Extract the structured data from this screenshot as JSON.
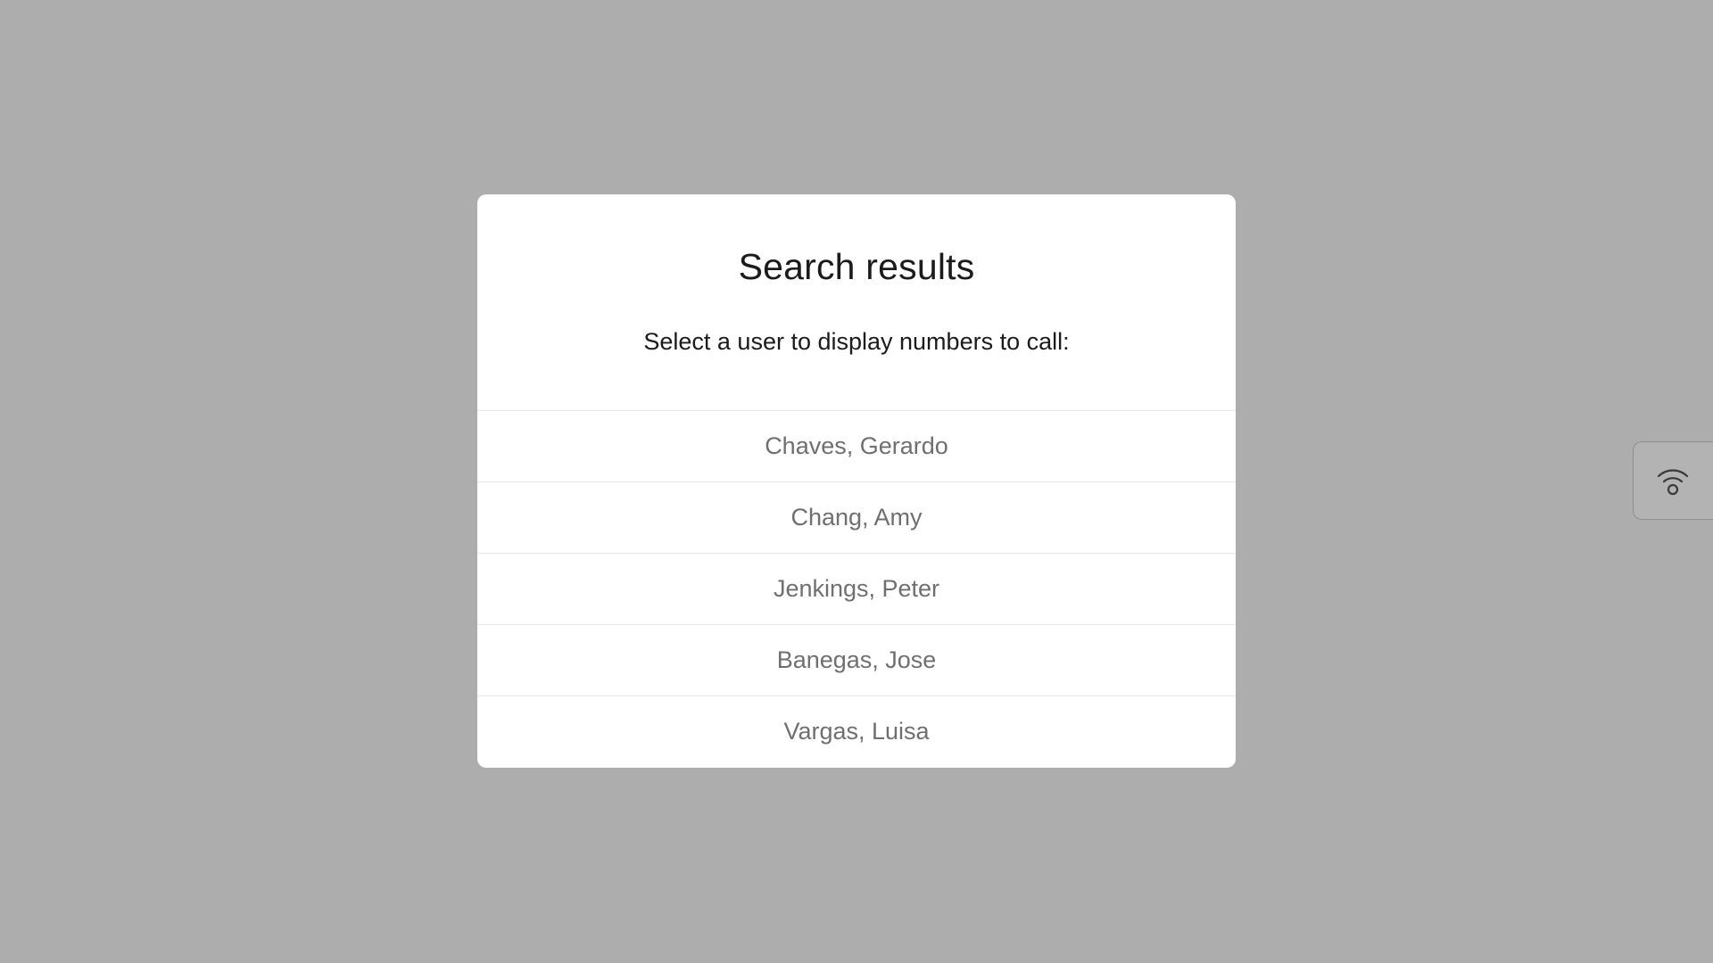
{
  "dialog": {
    "title": "Search results",
    "subtitle": "Select a user to display numbers to call:",
    "results": [
      "Chaves, Gerardo",
      "Chang, Amy",
      "Jenkings, Peter",
      "Banegas, Jose",
      "Vargas, Luisa"
    ]
  },
  "side_panel": {
    "icon": "wifi-icon"
  },
  "colors": {
    "backdrop": "#adadad",
    "dialog_bg": "#ffffff",
    "title_text": "#1b1b1b",
    "item_text": "#6f6f6f",
    "divider": "#e6e6e6"
  }
}
